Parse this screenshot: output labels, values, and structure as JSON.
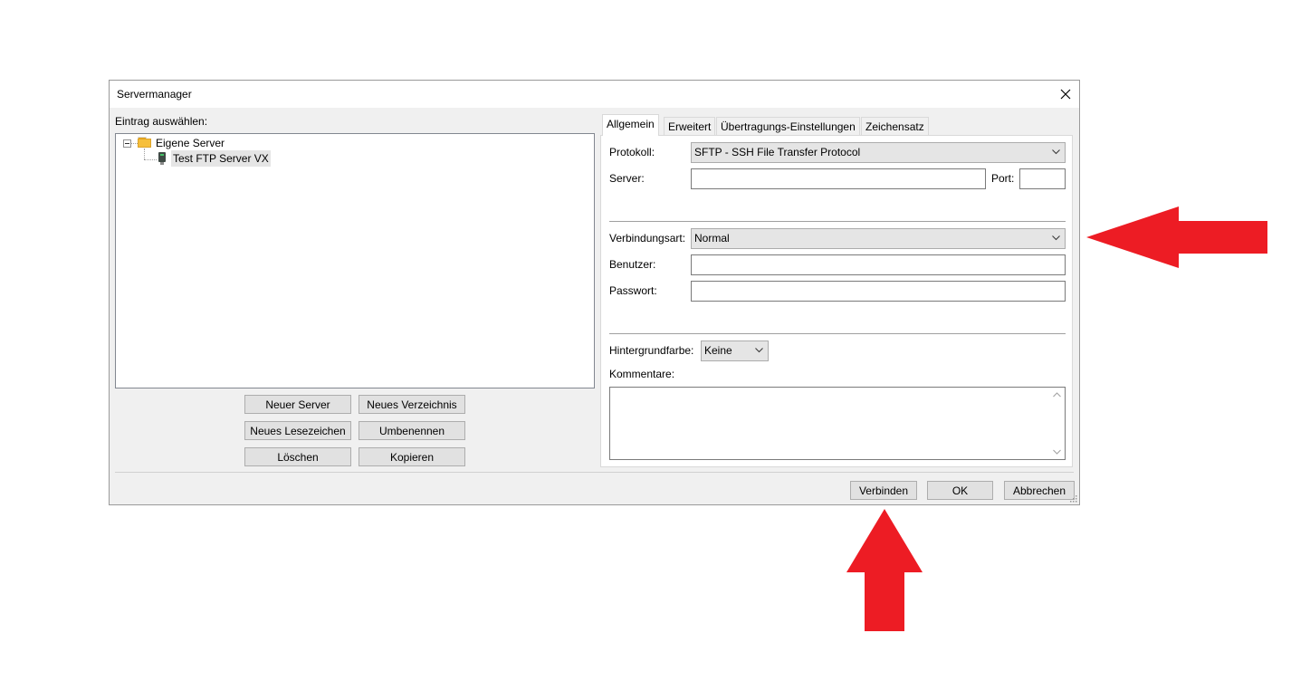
{
  "dialog": {
    "title": "Servermanager",
    "close_label": "Close"
  },
  "left": {
    "select_label": "Eintrag auswählen:",
    "tree": {
      "root_label": "Eigene Server",
      "child_label": "Test FTP Server VX"
    },
    "buttons": {
      "new_server": "Neuer Server",
      "new_folder": "Neues Verzeichnis",
      "new_bookmark": "Neues Lesezeichen",
      "rename": "Umbenennen",
      "delete": "Löschen",
      "copy": "Kopieren"
    }
  },
  "tabs": [
    "Allgemein",
    "Erweitert",
    "Übertragungs-Einstellungen",
    "Zeichensatz"
  ],
  "general": {
    "protocol_label": "Protokoll:",
    "protocol_value": "SFTP - SSH File Transfer Protocol",
    "server_label": "Server:",
    "server_value": "",
    "port_label": "Port:",
    "port_value": "",
    "logon_label": "Verbindungsart:",
    "logon_value": "Normal",
    "user_label": "Benutzer:",
    "user_value": "",
    "password_label": "Passwort:",
    "password_value": "",
    "bgcolor_label": "Hintergrundfarbe:",
    "bgcolor_value": "Keine",
    "comments_label": "Kommentare:",
    "comments_value": ""
  },
  "footer": {
    "connect": "Verbinden",
    "ok": "OK",
    "cancel": "Abbrechen"
  },
  "colors": {
    "annotation_arrow": "#ed1c24",
    "dialog_bg": "#f0f0f0",
    "button_bg": "#e1e1e1"
  },
  "icons": [
    "close-icon",
    "folder-icon",
    "server-icon",
    "chevron-down-icon",
    "arrow-left-annotation",
    "arrow-up-annotation"
  ]
}
